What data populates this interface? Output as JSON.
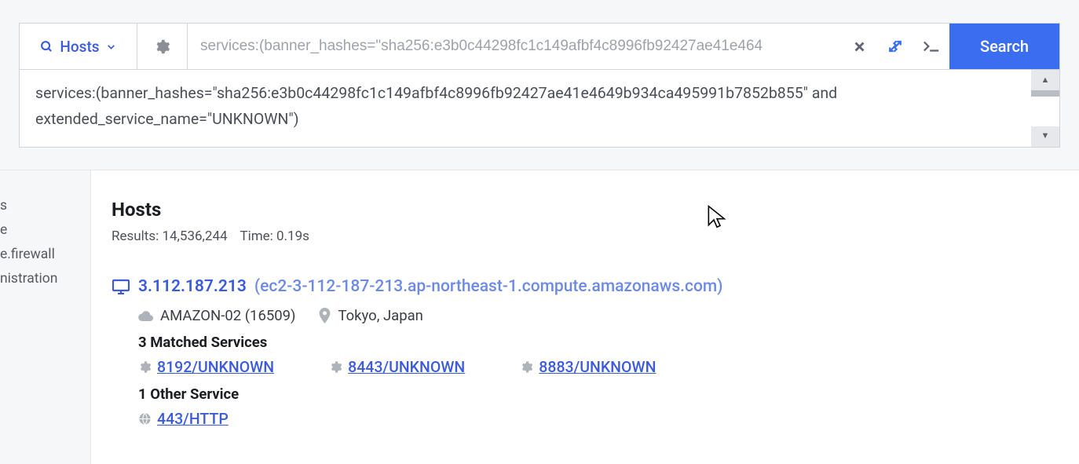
{
  "searchBar": {
    "hostsLabel": "Hosts",
    "query": "services:(banner_hashes=\"sha256:e3b0c44298fc1c149afbf4c8996fb92427ae41e4649b934ca495991b7852b855\" and extended_service_name=\"UNKNOWN\")",
    "queryTruncated": "services:(banner_hashes=\"sha256:e3b0c44298fc1c149afbf4c8996fb92427ae41e464",
    "searchLabel": "Search"
  },
  "expandedQuery": "services:(banner_hashes=\"sha256:e3b0c44298fc1c149afbf4c8996fb92427ae41e4649b934ca495991b7852b855\" and extended_service_name=\"UNKNOWN\")",
  "sidebar": {
    "frags": [
      "s",
      "e",
      "",
      "e.firewall",
      "nistration"
    ]
  },
  "results": {
    "title": "Hosts",
    "resultsLabel": "Results: 14,536,244",
    "timeLabel": "Time: 0.19s",
    "host": {
      "ip": "3.112.187.213",
      "hostname": "(ec2-3-112-187-213.ap-northeast-1.compute.amazonaws.com)",
      "asn": "AMAZON-02 (16509)",
      "location": "Tokyo, Japan",
      "matchedHeader": "3 Matched Services",
      "matchedServices": [
        "8192/UNKNOWN",
        "8443/UNKNOWN",
        "8883/UNKNOWN"
      ],
      "otherHeader": "1 Other Service",
      "otherServices": [
        "443/HTTP"
      ]
    }
  }
}
